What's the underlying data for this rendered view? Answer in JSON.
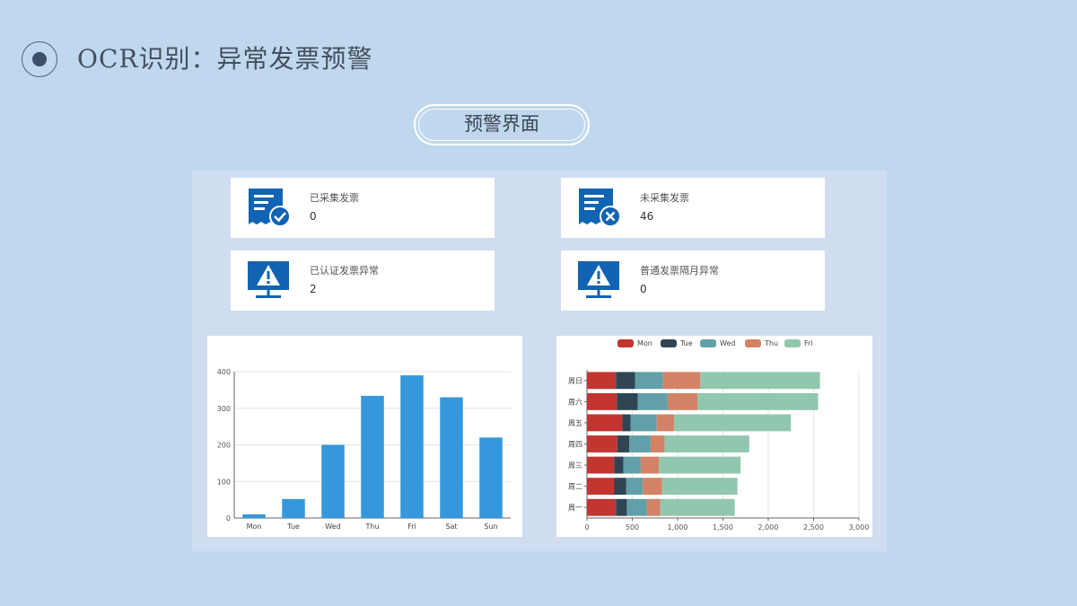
{
  "header": {
    "title": "OCR识别：异常发票预警"
  },
  "subtitle": "预警界面",
  "cards": [
    {
      "label": "已采集发票",
      "value": "0",
      "icon": "invoice-check-icon"
    },
    {
      "label": "未采集发票",
      "value": "46",
      "icon": "invoice-cross-icon"
    },
    {
      "label": "已认证发票异常",
      "value": "2",
      "icon": "warning-monitor-icon"
    },
    {
      "label": "普通发票隔月异常",
      "value": "0",
      "icon": "warning-monitor-icon"
    }
  ],
  "colors": {
    "icon": "#1163b3",
    "bar": "#3598dc",
    "Mon": "#c23531",
    "Tue": "#2f4554",
    "Wed": "#61a0a8",
    "Thu": "#d48265",
    "Fri": "#91c7ae"
  },
  "chart_data": [
    {
      "type": "bar",
      "categories": [
        "Mon",
        "Tue",
        "Wed",
        "Thu",
        "Fri",
        "Sat",
        "Sun"
      ],
      "values": [
        10,
        52,
        200,
        334,
        390,
        330,
        220
      ],
      "ylim": [
        0,
        400
      ],
      "yticks": [
        0,
        100,
        200,
        300,
        400
      ],
      "grid": true
    },
    {
      "type": "bar",
      "orientation": "horizontal-stacked",
      "categories": [
        "周一",
        "周二",
        "周三",
        "周四",
        "周五",
        "周六",
        "周日"
      ],
      "series": [
        {
          "name": "Mon",
          "values": [
            320,
            302,
            301,
            334,
            390,
            330,
            320
          ]
        },
        {
          "name": "Tue",
          "values": [
            120,
            132,
            101,
            134,
            90,
            230,
            210
          ]
        },
        {
          "name": "Wed",
          "values": [
            220,
            182,
            191,
            234,
            290,
            330,
            310
          ]
        },
        {
          "name": "Thu",
          "values": [
            150,
            212,
            201,
            154,
            190,
            330,
            410
          ]
        },
        {
          "name": "Fri",
          "values": [
            820,
            832,
            901,
            934,
            1290,
            1330,
            1320
          ]
        }
      ],
      "xlim": [
        0,
        3000
      ],
      "xticks": [
        "0",
        "500",
        "1,000",
        "1,500",
        "2,000",
        "2,500",
        "3,000"
      ],
      "legend": "top-center",
      "grid": true
    }
  ]
}
